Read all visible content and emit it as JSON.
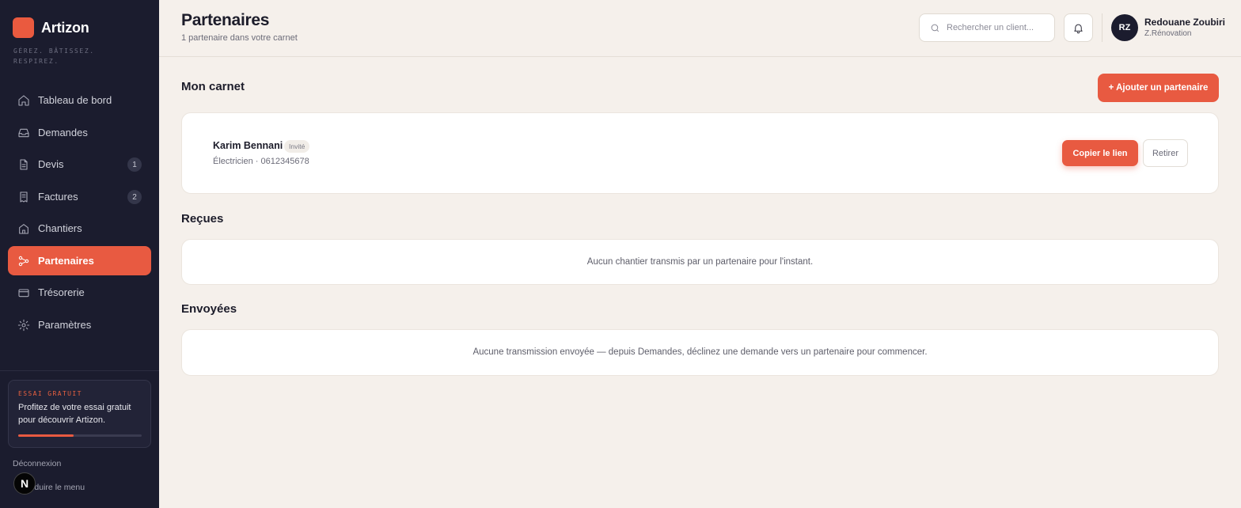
{
  "brand": {
    "name": "Artizon",
    "tagline": "Gérez. Bâtissez. Respirez.",
    "accent": "#e85a41",
    "sidebar_bg": "#1b1c2e",
    "page_bg": "#f5f0eb"
  },
  "sidebar": {
    "items": [
      {
        "label": "Tableau de bord",
        "icon": "home-icon"
      },
      {
        "label": "Demandes",
        "icon": "inbox-icon"
      },
      {
        "label": "Devis",
        "icon": "document-icon",
        "badge": "1"
      },
      {
        "label": "Factures",
        "icon": "receipt-icon",
        "badge": "2"
      },
      {
        "label": "Chantiers",
        "icon": "building-icon"
      },
      {
        "label": "Partenaires",
        "icon": "share-icon",
        "active": true
      },
      {
        "label": "Trésorerie",
        "icon": "wallet-icon"
      },
      {
        "label": "Paramètres",
        "icon": "gear-icon"
      }
    ],
    "trial": {
      "label": "Essai gratuit",
      "text": "Profitez de votre essai gratuit pour découvrir Artizon.",
      "progress": 0.45
    },
    "logout": "Déconnexion",
    "collapse": "Réduire le menu",
    "overlay_badge": "N"
  },
  "header": {
    "title": "Partenaires",
    "subtitle": "1 partenaire dans votre carnet",
    "search_placeholder": "Rechercher un client...",
    "user": {
      "initials": "RZ",
      "name": "Redouane Zoubiri",
      "company": "Z.Rénovation"
    }
  },
  "main": {
    "carnet": {
      "title": "Mon carnet",
      "add_label": "+ Ajouter un partenaire",
      "partners": [
        {
          "name": "Karim Bennani",
          "status": "Invité",
          "meta": "Électricien · 0612345678",
          "copy_label": "Copier le lien",
          "remove_label": "Retirer"
        }
      ]
    },
    "received": {
      "title": "Reçues",
      "empty": "Aucun chantier transmis par un partenaire pour l'instant."
    },
    "sent": {
      "title": "Envoyées",
      "empty": "Aucune transmission envoyée — depuis Demandes, déclinez une demande vers un partenaire pour commencer."
    }
  }
}
